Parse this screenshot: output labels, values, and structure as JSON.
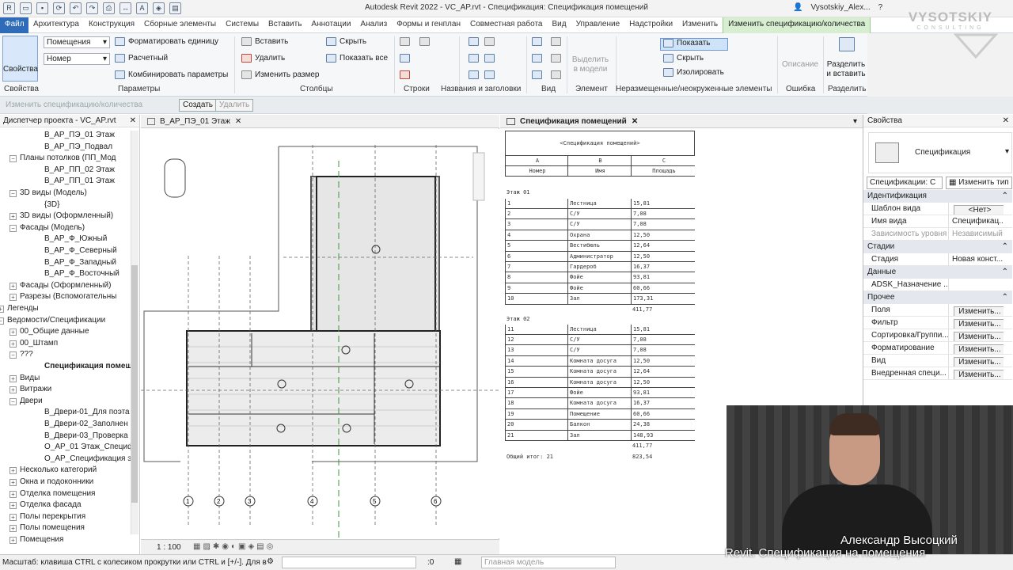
{
  "app": {
    "title": "Autodesk Revit 2022 - VC_AP.rvt - Спецификация: Спецификация помещений",
    "user": "Vysotskiy_Alex...",
    "help": "?"
  },
  "ribbon_tabs": [
    "Файл",
    "Архитектура",
    "Конструкция",
    "Сборные элементы",
    "Системы",
    "Вставить",
    "Аннотации",
    "Анализ",
    "Формы и генплан",
    "Совместная работа",
    "Вид",
    "Управление",
    "Надстройки",
    "Изменить",
    "Изменить спецификацию/количества"
  ],
  "ribbon": {
    "properties_btn": "Свойства",
    "select_type": "Помещения",
    "select_param": "Номер",
    "format_unit": "Форматировать единицу",
    "calculated": "Расчетный",
    "combine_params": "Комбинировать параметры",
    "insert": "Вставить",
    "delete": "Удалить",
    "resize": "Изменить размер",
    "hide": "Скрыть",
    "show_all": "Показать все",
    "select_in_model": "Выделить в модели",
    "show": "Показать",
    "hide2": "Скрыть",
    "isolate": "Изолировать",
    "description": "Описание",
    "split_insert": "Разделить и вставить",
    "groups": [
      "Свойства",
      "Параметры",
      "Столбцы",
      "Строки",
      "Названия и заголовки",
      "Вид",
      "Элемент",
      "Неразмещенные/неокруженные элементы",
      "Ошибка",
      "Разделить"
    ]
  },
  "contextbar": {
    "label": "Изменить спецификацию/количества",
    "create": "Создать",
    "delete": "Удалить"
  },
  "project_browser": {
    "title": "Диспетчер проекта - VC_AP.rvt",
    "items": [
      {
        "label": "В_АР_ПЭ_01 Этаж",
        "toggle": ""
      },
      {
        "label": "В_АР_ПЭ_Подвал",
        "toggle": ""
      },
      {
        "label": "Планы потолков (ПП_Мод",
        "toggle": "−"
      },
      {
        "label": "В_АР_ПП_02 Этаж",
        "toggle": ""
      },
      {
        "label": "В_АР_ПП_01 Этаж",
        "toggle": ""
      },
      {
        "label": "3D виды (Модель)",
        "toggle": "−"
      },
      {
        "label": "{3D}",
        "toggle": ""
      },
      {
        "label": "3D виды (Оформленный)",
        "toggle": "+"
      },
      {
        "label": "Фасады (Модель)",
        "toggle": "−"
      },
      {
        "label": "В_АР_Ф_Южный",
        "toggle": ""
      },
      {
        "label": "В_АР_Ф_Северный",
        "toggle": ""
      },
      {
        "label": "В_АР_Ф_Западный",
        "toggle": ""
      },
      {
        "label": "В_АР_Ф_Восточный",
        "toggle": ""
      },
      {
        "label": "Фасады (Оформленный)",
        "toggle": "+"
      },
      {
        "label": "Разрезы (Вспомогательны",
        "toggle": "+"
      },
      {
        "label": "Легенды",
        "toggle": "+"
      },
      {
        "label": "Ведомости/Спецификации",
        "toggle": "−"
      },
      {
        "label": "00_Общие данные",
        "toggle": "+"
      },
      {
        "label": "00_Штамп",
        "toggle": "+"
      },
      {
        "label": "???",
        "toggle": "−"
      },
      {
        "label": "Спецификация помещ",
        "toggle": ""
      },
      {
        "label": "Виды",
        "toggle": "+"
      },
      {
        "label": "Витражи",
        "toggle": "+"
      },
      {
        "label": "Двери",
        "toggle": "−"
      },
      {
        "label": "В_Двери-01_Для поэта",
        "toggle": ""
      },
      {
        "label": "В_Двери-02_Заполнен",
        "toggle": ""
      },
      {
        "label": "В_Двери-03_Проверка",
        "toggle": ""
      },
      {
        "label": "О_АР_01 Этаж_Специф",
        "toggle": ""
      },
      {
        "label": "О_АР_Спецификация э",
        "toggle": ""
      },
      {
        "label": "Несколько категорий",
        "toggle": "+"
      },
      {
        "label": "Окна и подоконники",
        "toggle": "+"
      },
      {
        "label": "Отделка помещения",
        "toggle": "+"
      },
      {
        "label": "Отделка фасада",
        "toggle": "+"
      },
      {
        "label": "Полы перекрытия",
        "toggle": "+"
      },
      {
        "label": "Полы помещения",
        "toggle": "+"
      },
      {
        "label": "Помещения",
        "toggle": "+"
      }
    ]
  },
  "plan_view": {
    "tab": "В_АР_ПЭ_01 Этаж",
    "scale": "1 : 100",
    "grid_labels": [
      "1",
      "2",
      "3",
      "4",
      "5",
      "6"
    ]
  },
  "schedule": {
    "tab": "Спецификация помещений",
    "title": "<Спецификация помещений>",
    "col_letters": [
      "A",
      "B",
      "C"
    ],
    "col_headers": [
      "Номер",
      "Имя",
      "Площадь"
    ],
    "floor1": "Этаж 01",
    "rows1": [
      [
        "1",
        "Лестница",
        "15,81"
      ],
      [
        "2",
        "С/У",
        "7,08"
      ],
      [
        "3",
        "С/У",
        "7,08"
      ],
      [
        "4",
        "Охрана",
        "12,50"
      ],
      [
        "5",
        "Вестибюль",
        "12,64"
      ],
      [
        "6",
        "Администратор",
        "12,50"
      ],
      [
        "7",
        "Гардероб",
        "16,37"
      ],
      [
        "8",
        "Фойе",
        "93,81"
      ],
      [
        "9",
        "Фойе",
        "60,66"
      ],
      [
        "10",
        "Зал",
        "173,31"
      ]
    ],
    "subtotal1": "411,77",
    "floor2": "Этаж 02",
    "rows2": [
      [
        "11",
        "Лестница",
        "15,81"
      ],
      [
        "12",
        "С/У",
        "7,08"
      ],
      [
        "13",
        "С/У",
        "7,08"
      ],
      [
        "14",
        "Комната досуга",
        "12,50"
      ],
      [
        "15",
        "Комната досуга",
        "12,64"
      ],
      [
        "16",
        "Комната досуга",
        "12,50"
      ],
      [
        "17",
        "Фойе",
        "93,81"
      ],
      [
        "18",
        "Комната досуга",
        "16,37"
      ],
      [
        "19",
        "Помещение",
        "60,66"
      ],
      [
        "20",
        "Балкон",
        "24,38"
      ],
      [
        "21",
        "Зал",
        "148,93"
      ]
    ],
    "subtotal2": "411,77",
    "total_label": "Общий итог: 21",
    "total": "823,54"
  },
  "properties": {
    "title": "Свойства",
    "type_name": "Спецификация",
    "selector": "Спецификации: С",
    "edit_type": "Изменить тип",
    "sections": [
      {
        "name": "Идентификация",
        "rows": [
          {
            "k": "Шаблон вида",
            "v": "<Нет>",
            "btn": true
          },
          {
            "k": "Имя вида",
            "v": "Спецификац...",
            "btn": false
          },
          {
            "k": "Зависимость уровня",
            "v": "Независимый",
            "btn": false
          }
        ]
      },
      {
        "name": "Стадии",
        "rows": [
          {
            "k": "Стадия",
            "v": "Новая конст...",
            "btn": false
          }
        ]
      },
      {
        "name": "Данные",
        "rows": [
          {
            "k": "ADSK_Назначение ...",
            "v": "",
            "btn": false
          }
        ]
      },
      {
        "name": "Прочее",
        "rows": [
          {
            "k": "Поля",
            "v": "Изменить...",
            "btn": true
          },
          {
            "k": "Фильтр",
            "v": "Изменить...",
            "btn": true
          },
          {
            "k": "Сортировка/Группи...",
            "v": "Изменить...",
            "btn": true
          },
          {
            "k": "Форматирование",
            "v": "Изменить...",
            "btn": true
          },
          {
            "k": "Вид",
            "v": "Изменить...",
            "btn": true
          },
          {
            "k": "Внедренная специ...",
            "v": "Изменить...",
            "btn": true
          }
        ]
      }
    ]
  },
  "statusbar": {
    "hint": "Масштаб: клавиша CTRL с колесиком прокрутки или CTRL и [+/-]. Для в",
    "coord": ":0",
    "model": "Главная модель"
  },
  "overlay": {
    "brand": "VYSOTSKIY",
    "brand_sub": "CONSULTING",
    "name": "Александр Высоцкий",
    "course": "Revit. Спецификация на помещения"
  },
  "colors": {
    "accent": "#2e6bb8",
    "context_tab": "#d7efd0"
  }
}
